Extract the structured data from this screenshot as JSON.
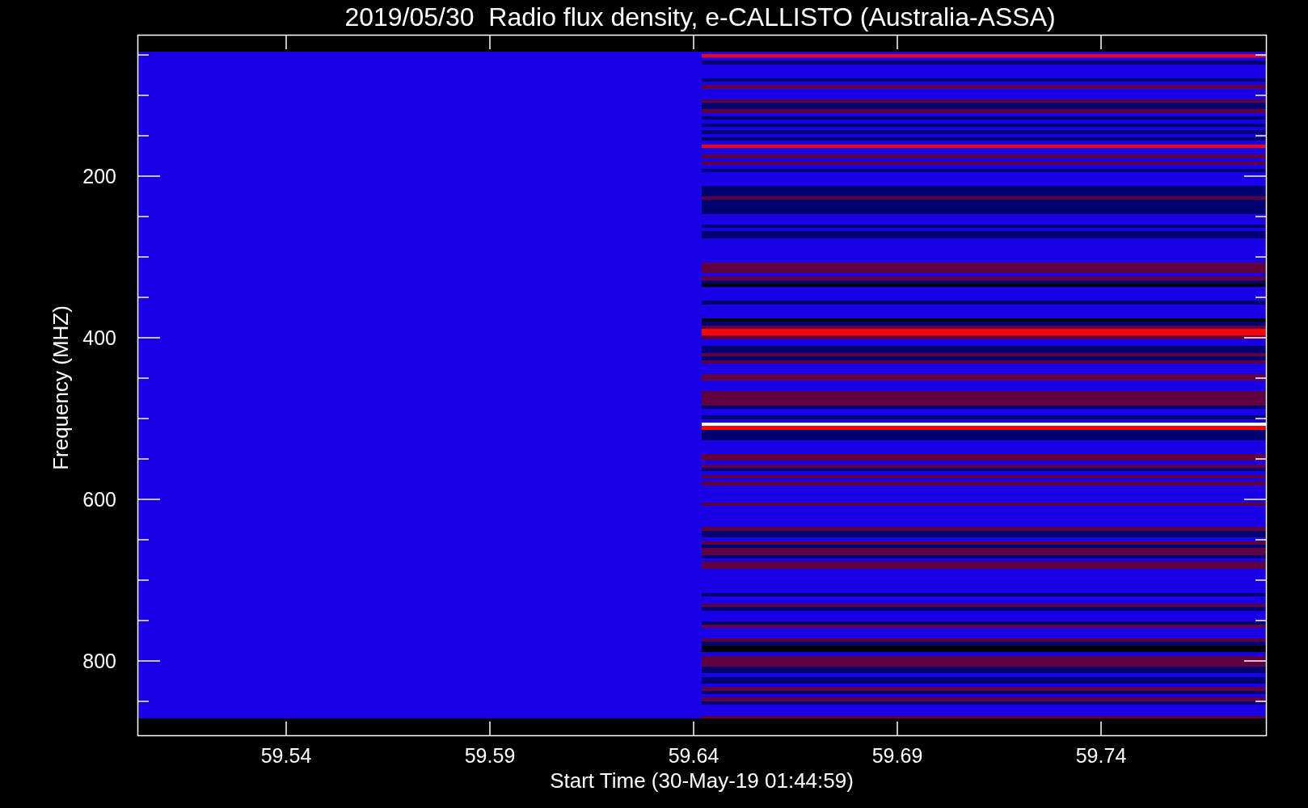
{
  "plot": {
    "title": "2019/05/30  Radio flux density, e-CALLISTO (Australia-ASSA)",
    "xlabel": "Start Time (30-May-19 01:44:59)",
    "ylabel": "Frequency (MHZ)",
    "xtick_labels": [
      "59.54",
      "59.59",
      "59.64",
      "59.69",
      "59.74"
    ],
    "ytick_labels": [
      "200",
      "400",
      "600",
      "800"
    ]
  }
}
